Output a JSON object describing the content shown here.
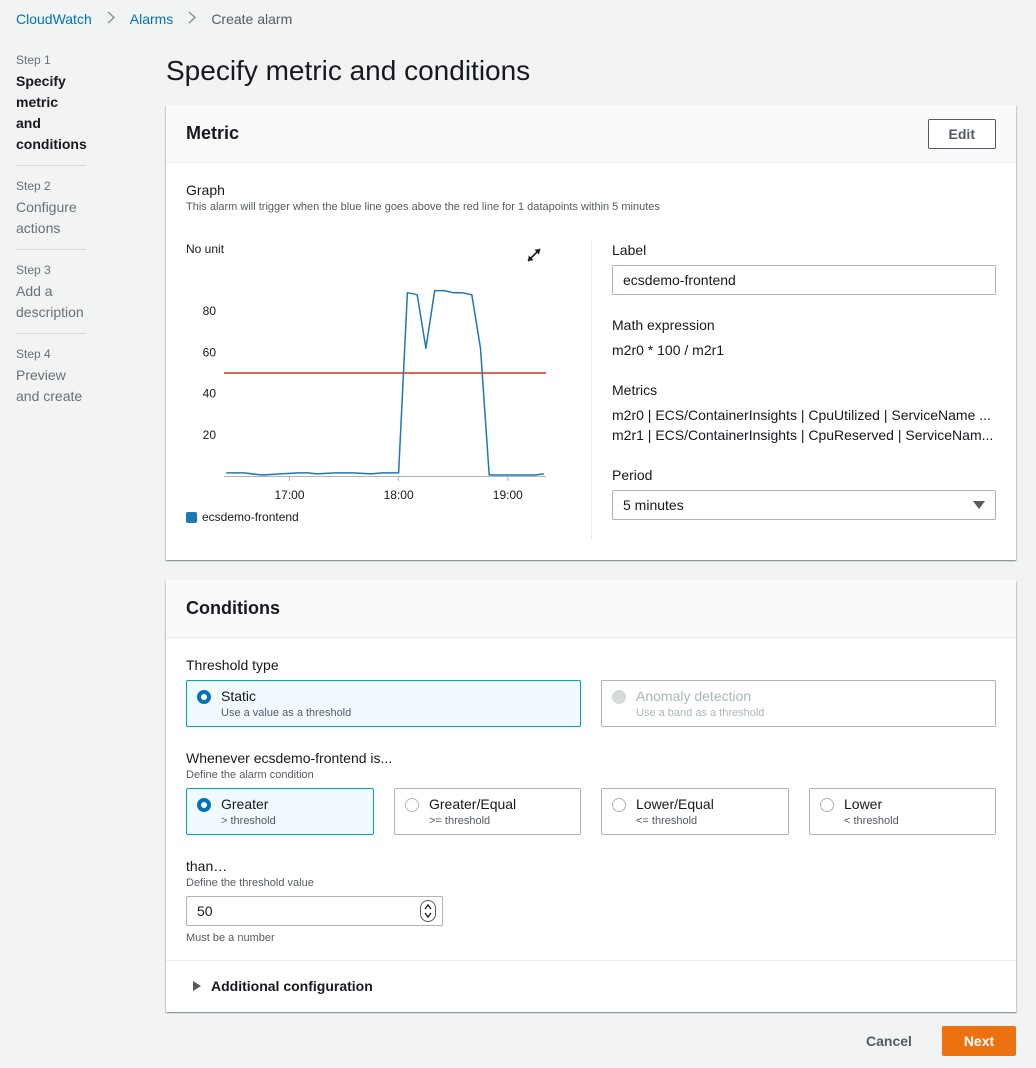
{
  "breadcrumb": {
    "root": "CloudWatch",
    "alarms": "Alarms",
    "current": "Create alarm"
  },
  "steps": [
    {
      "num": "Step 1",
      "title": "Specify metric and conditions",
      "active": true
    },
    {
      "num": "Step 2",
      "title": "Configure actions",
      "active": false
    },
    {
      "num": "Step 3",
      "title": "Add a description",
      "active": false
    },
    {
      "num": "Step 4",
      "title": "Preview and create",
      "active": false
    }
  ],
  "page_title": "Specify metric and conditions",
  "metric": {
    "header": "Metric",
    "edit_label": "Edit",
    "graph_title": "Graph",
    "graph_desc": "This alarm will trigger when the blue line goes above the red line for 1 datapoints within 5 minutes",
    "unit": "No unit",
    "label_title": "Label",
    "label_value": "ecsdemo-frontend",
    "math_title": "Math expression",
    "math_value": "m2r0 * 100 / m2r1",
    "metrics_title": "Metrics",
    "metrics": [
      "m2r0 | ECS/ContainerInsights | CpuUtilized | ServiceName ...",
      "m2r1 | ECS/ContainerInsights | CpuReserved | ServiceNam..."
    ],
    "period_title": "Period",
    "period_value": "5 minutes",
    "icons": {
      "expand": "expand-icon",
      "dropdown": "caret-down-icon"
    }
  },
  "chart_data": {
    "type": "line",
    "ylim": [
      0,
      100
    ],
    "yticks": [
      20,
      40,
      60,
      80
    ],
    "x_tick_labels": [
      "17:00",
      "18:00",
      "19:00"
    ],
    "x_tick_positions": [
      17.0,
      18.0,
      19.0
    ],
    "xlim": [
      16.4,
      19.35
    ],
    "threshold": 50,
    "threshold_color": "#d13212",
    "series": [
      {
        "name": "ecsdemo-frontend",
        "color": "#1f77b4",
        "x": [
          16.42,
          16.58,
          16.75,
          16.92,
          17.08,
          17.17,
          17.25,
          17.42,
          17.58,
          17.75,
          17.85,
          18.0,
          18.08,
          18.17,
          18.25,
          18.33,
          18.42,
          18.5,
          18.58,
          18.67,
          18.75,
          18.83,
          18.92,
          19.0,
          19.08,
          19.17,
          19.25,
          19.33
        ],
        "y": [
          1.5,
          1.5,
          0.5,
          1,
          1.5,
          1.5,
          1,
          1.5,
          1.5,
          1,
          1.5,
          1.5,
          89,
          88,
          62,
          90,
          90,
          89,
          89,
          88,
          62,
          0.5,
          0.5,
          0.5,
          0.5,
          0.5,
          0.5,
          1
        ]
      }
    ]
  },
  "conditions": {
    "header": "Conditions",
    "threshold_type_label": "Threshold type",
    "threshold_types": [
      {
        "title": "Static",
        "desc": "Use a value as a threshold",
        "selected": true,
        "disabled": false
      },
      {
        "title": "Anomaly detection",
        "desc": "Use a band as a threshold",
        "selected": false,
        "disabled": true
      }
    ],
    "whenever_label": "Whenever ecsdemo-frontend is...",
    "whenever_sub": "Define the alarm condition",
    "operators": [
      {
        "title": "Greater",
        "desc": "> threshold",
        "selected": true
      },
      {
        "title": "Greater/Equal",
        "desc": ">= threshold",
        "selected": false
      },
      {
        "title": "Lower/Equal",
        "desc": "<= threshold",
        "selected": false
      },
      {
        "title": "Lower",
        "desc": "< threshold",
        "selected": false
      }
    ],
    "than_label": "than…",
    "than_sub": "Define the threshold value",
    "threshold_value": "50",
    "hint": "Must be a number",
    "additional": "Additional configuration"
  },
  "footer": {
    "cancel": "Cancel",
    "next": "Next"
  }
}
